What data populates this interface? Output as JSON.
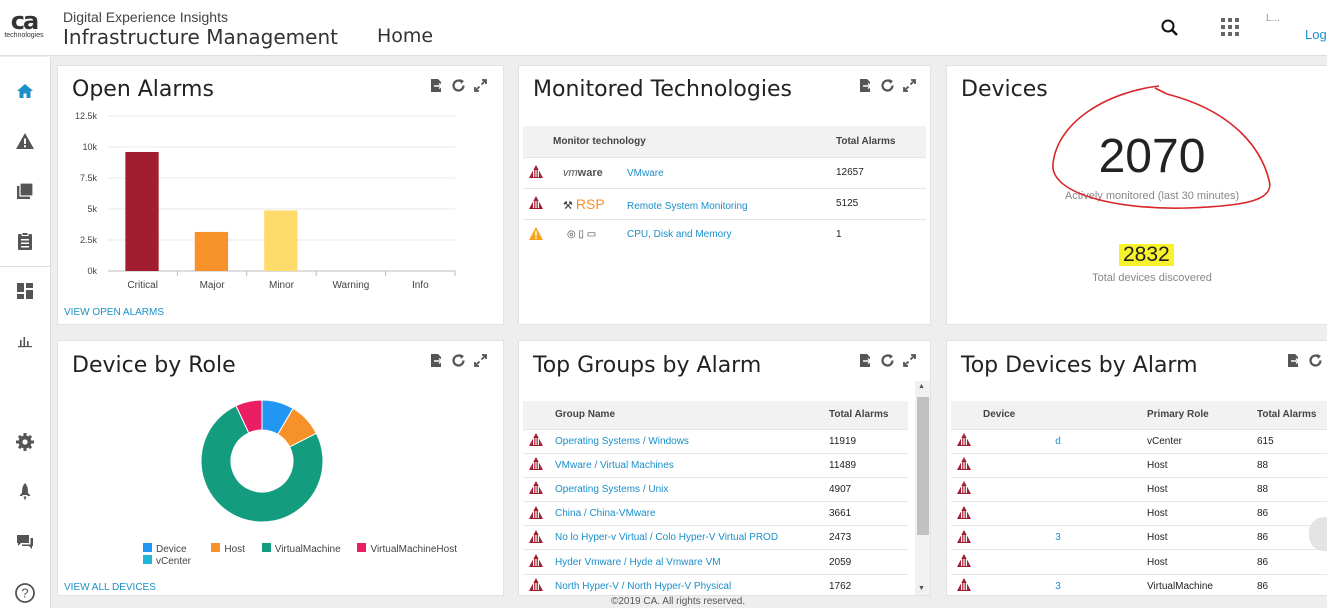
{
  "header": {
    "logo_text": "ca",
    "logo_sub": "technologies",
    "app_subtitle": "Digital Experience Insights",
    "app_title": "Infrastructure Management",
    "page": "Home",
    "user_name": "L...",
    "logout": "Log"
  },
  "sidebar": {
    "items": [
      {
        "icon": "home-icon"
      },
      {
        "icon": "alarm-icon"
      },
      {
        "icon": "inventory-icon"
      },
      {
        "icon": "report-icon"
      },
      {
        "icon": "dashboard-icon"
      },
      {
        "icon": "chart-icon"
      },
      {
        "icon": "gear-icon"
      },
      {
        "icon": "rocket-icon"
      },
      {
        "icon": "chat-icon"
      },
      {
        "icon": "help-icon"
      }
    ]
  },
  "open_alarms": {
    "title": "Open Alarms",
    "link": "VIEW OPEN ALARMS",
    "colors": {
      "Critical": "#a11d30",
      "Major": "#f7922a",
      "Minor": "#fddc6c",
      "Warning": "#f2e94e",
      "Info": "#2ea3dc"
    }
  },
  "chart_data": {
    "type": "bar",
    "title": "Open Alarms",
    "categories": [
      "Critical",
      "Major",
      "Minor",
      "Warning",
      "Info"
    ],
    "values": [
      9600,
      3150,
      4880,
      0,
      0
    ],
    "ylim": [
      0,
      12500
    ],
    "yticks": [
      "0k",
      "2.5k",
      "5k",
      "7.5k",
      "10k",
      "12.5k"
    ],
    "xlabel": "",
    "ylabel": "",
    "grid": true
  },
  "monitored": {
    "title": "Monitored Technologies",
    "col1": "Monitor technology",
    "col2": "Total Alarms",
    "rows": [
      {
        "logo": "vmware",
        "name": "VMware",
        "count": "12657",
        "severity": "critical"
      },
      {
        "logo": "RSP",
        "name": "Remote System Monitoring",
        "count": "5125",
        "severity": "critical"
      },
      {
        "logo": "cpu",
        "name": "CPU, Disk and Memory",
        "count": "1",
        "severity": "warning"
      }
    ]
  },
  "devices": {
    "title": "Devices",
    "monitored": "2070",
    "monitored_label": "Actively monitored (last 30 minutes)",
    "discovered": "2832",
    "discovered_label": "Total devices discovered"
  },
  "device_role": {
    "title": "Device by Role",
    "link": "VIEW ALL DEVICES",
    "legend": [
      "Device",
      "Host",
      "VirtualMachine",
      "VirtualMachineHost",
      "vCenter"
    ],
    "colors": [
      "#2196f3",
      "#f7922a",
      "#149c7f",
      "#e91e63",
      "#1fb5d6"
    ],
    "slices": [
      {
        "name": "Device",
        "value": 0.085,
        "color": "#2196f3"
      },
      {
        "name": "Host",
        "value": 0.09,
        "color": "#f7922a"
      },
      {
        "name": "VirtualMachine",
        "value": 0.755,
        "color": "#149c7f"
      },
      {
        "name": "VirtualMachineHost",
        "value": 0.07,
        "color": "#e91e63"
      }
    ]
  },
  "top_groups": {
    "title": "Top Groups by Alarm",
    "col1": "Group Name",
    "col2": "Total Alarms",
    "rows": [
      {
        "name": "Operating Systems / Windows",
        "count": "11919"
      },
      {
        "name": "VMware / Virtual Machines",
        "count": "11489"
      },
      {
        "name": "Operating Systems / Unix",
        "count": "4907"
      },
      {
        "name": "China / China-VMware",
        "count": "3661"
      },
      {
        "name": "No        lo Hyper-v Virtual /       Colo Hyper-V Virtual PROD",
        "count": "2473"
      },
      {
        "name": "Hyder           Vmware / Hyde          al Vmware VM",
        "count": "2059"
      },
      {
        "name": "North       Hyper-V / North         Hyper-V Physical",
        "count": "1762"
      }
    ]
  },
  "top_devices": {
    "title": "Top Devices by Alarm",
    "col1": "Device",
    "col2": "Primary Role",
    "col3": "Total Alarms",
    "rows": [
      {
        "name": "                          d",
        "role": "vCenter",
        "count": "615"
      },
      {
        "name": "",
        "role": "Host",
        "count": "88"
      },
      {
        "name": "",
        "role": "Host",
        "count": "88"
      },
      {
        "name": "",
        "role": "Host",
        "count": "86"
      },
      {
        "name": "                          3",
        "role": "Host",
        "count": "86"
      },
      {
        "name": "",
        "role": "Host",
        "count": "86"
      },
      {
        "name": "                          3",
        "role": "VirtualMachine",
        "count": "86"
      }
    ]
  },
  "footer": "©2019 CA. All rights reserved."
}
